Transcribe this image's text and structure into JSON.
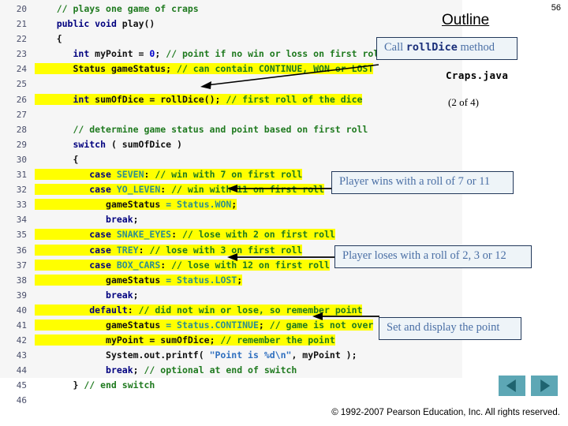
{
  "page": {
    "number": "56",
    "title": "Outline",
    "file_label": "Craps.java",
    "progress": "(2 of 4)"
  },
  "code": {
    "first_line_number": 20,
    "lines": [
      {
        "n": "20",
        "hl": false,
        "segs": [
          {
            "t": "    ",
            "c": "pl"
          },
          {
            "t": "// plays one game of craps",
            "c": "cm"
          }
        ]
      },
      {
        "n": "21",
        "hl": false,
        "segs": [
          {
            "t": "    ",
            "c": "pl"
          },
          {
            "t": "public void ",
            "c": "kw"
          },
          {
            "t": "play()",
            "c": "pl"
          }
        ]
      },
      {
        "n": "22",
        "hl": false,
        "segs": [
          {
            "t": "    {",
            "c": "pl"
          }
        ]
      },
      {
        "n": "23",
        "hl": false,
        "segs": [
          {
            "t": "       ",
            "c": "pl"
          },
          {
            "t": "int ",
            "c": "kw"
          },
          {
            "t": "myPoint = ",
            "c": "pl"
          },
          {
            "t": "0",
            "c": "num"
          },
          {
            "t": "; ",
            "c": "pl"
          },
          {
            "t": "// point if no win or loss on first roll",
            "c": "cm"
          }
        ]
      },
      {
        "n": "24",
        "hl": true,
        "segs": [
          {
            "t": "       ",
            "c": "pl"
          },
          {
            "t": "Status ",
            "c": "pl"
          },
          {
            "t": "gameStatus; ",
            "c": "pl"
          },
          {
            "t": "// can contain CONTINUE, WON or LOST",
            "c": "cm"
          }
        ]
      },
      {
        "n": "25",
        "hl": false,
        "segs": [
          {
            "t": "",
            "c": "pl"
          }
        ]
      },
      {
        "n": "26",
        "hl": true,
        "segs": [
          {
            "t": "       ",
            "c": "pl"
          },
          {
            "t": "int ",
            "c": "kw"
          },
          {
            "t": "sumOfDice = rollDice(); ",
            "c": "pl"
          },
          {
            "t": "// first roll of the dice",
            "c": "cm"
          }
        ]
      },
      {
        "n": "27",
        "hl": false,
        "segs": [
          {
            "t": "",
            "c": "pl"
          }
        ]
      },
      {
        "n": "28",
        "hl": false,
        "segs": [
          {
            "t": "       ",
            "c": "pl"
          },
          {
            "t": "// determine game status and point based on first roll",
            "c": "cm"
          }
        ]
      },
      {
        "n": "29",
        "hl": false,
        "segs": [
          {
            "t": "       ",
            "c": "pl"
          },
          {
            "t": "switch ",
            "c": "kw"
          },
          {
            "t": "( sumOfDice )",
            "c": "pl"
          }
        ]
      },
      {
        "n": "30",
        "hl": false,
        "segs": [
          {
            "t": "       {",
            "c": "pl"
          }
        ]
      },
      {
        "n": "31",
        "hl": true,
        "segs": [
          {
            "t": "          ",
            "c": "pl"
          },
          {
            "t": "case ",
            "c": "kw"
          },
          {
            "t": "SEVEN",
            "c": "ty"
          },
          {
            "t": ": ",
            "c": "pl"
          },
          {
            "t": "// win with 7 on first roll",
            "c": "cm"
          }
        ]
      },
      {
        "n": "32",
        "hl": true,
        "segs": [
          {
            "t": "          ",
            "c": "pl"
          },
          {
            "t": "case ",
            "c": "kw"
          },
          {
            "t": "YO_LEVEN",
            "c": "ty"
          },
          {
            "t": ": ",
            "c": "pl"
          },
          {
            "t": "// win with 11 on first roll",
            "c": "cm"
          }
        ]
      },
      {
        "n": "33",
        "hl": true,
        "segs": [
          {
            "t": "             ",
            "c": "pl"
          },
          {
            "t": "gameStatus ",
            "c": "pl"
          },
          {
            "t": "= ",
            "c": "ty"
          },
          {
            "t": "Status.",
            "c": "ty"
          },
          {
            "t": "WON",
            "c": "ty"
          },
          {
            "t": ";",
            "c": "pl"
          }
        ]
      },
      {
        "n": "34",
        "hl": false,
        "segs": [
          {
            "t": "             ",
            "c": "pl"
          },
          {
            "t": "break",
            "c": "kw"
          },
          {
            "t": ";",
            "c": "pl"
          }
        ]
      },
      {
        "n": "35",
        "hl": true,
        "segs": [
          {
            "t": "          ",
            "c": "pl"
          },
          {
            "t": "case ",
            "c": "kw"
          },
          {
            "t": "SNAKE_EYES",
            "c": "ty"
          },
          {
            "t": ": ",
            "c": "pl"
          },
          {
            "t": "// lose with 2 on first roll",
            "c": "cm"
          }
        ]
      },
      {
        "n": "36",
        "hl": true,
        "segs": [
          {
            "t": "          ",
            "c": "pl"
          },
          {
            "t": "case ",
            "c": "kw"
          },
          {
            "t": "TREY",
            "c": "ty"
          },
          {
            "t": ": ",
            "c": "pl"
          },
          {
            "t": "// lose with 3 on first roll",
            "c": "cm"
          }
        ]
      },
      {
        "n": "37",
        "hl": true,
        "segs": [
          {
            "t": "          ",
            "c": "pl"
          },
          {
            "t": "case ",
            "c": "kw"
          },
          {
            "t": "BOX_CARS",
            "c": "ty"
          },
          {
            "t": ": ",
            "c": "pl"
          },
          {
            "t": "// lose with 12 on first roll",
            "c": "cm"
          }
        ]
      },
      {
        "n": "38",
        "hl": true,
        "segs": [
          {
            "t": "             ",
            "c": "pl"
          },
          {
            "t": "gameStatus ",
            "c": "pl"
          },
          {
            "t": "= ",
            "c": "ty"
          },
          {
            "t": "Status.",
            "c": "ty"
          },
          {
            "t": "LOST",
            "c": "ty"
          },
          {
            "t": ";",
            "c": "pl"
          }
        ]
      },
      {
        "n": "39",
        "hl": false,
        "segs": [
          {
            "t": "             ",
            "c": "pl"
          },
          {
            "t": "break",
            "c": "kw"
          },
          {
            "t": ";",
            "c": "pl"
          }
        ]
      },
      {
        "n": "40",
        "hl": true,
        "segs": [
          {
            "t": "          ",
            "c": "pl"
          },
          {
            "t": "default",
            "c": "kw"
          },
          {
            "t": ": ",
            "c": "pl"
          },
          {
            "t": "// did not win or lose, so remember point",
            "c": "cm"
          }
        ]
      },
      {
        "n": "41",
        "hl": true,
        "segs": [
          {
            "t": "             ",
            "c": "pl"
          },
          {
            "t": "gameStatus ",
            "c": "pl"
          },
          {
            "t": "= ",
            "c": "ty"
          },
          {
            "t": "Status.CONTINUE",
            "c": "ty"
          },
          {
            "t": "; ",
            "c": "pl"
          },
          {
            "t": "// game is not over",
            "c": "cm"
          }
        ]
      },
      {
        "n": "42",
        "hl": true,
        "segs": [
          {
            "t": "             ",
            "c": "pl"
          },
          {
            "t": "myPoint = sumOfDice; ",
            "c": "pl"
          },
          {
            "t": "// remember the point",
            "c": "cm"
          }
        ]
      },
      {
        "n": "43",
        "hl": false,
        "segs": [
          {
            "t": "             ",
            "c": "pl"
          },
          {
            "t": "System.out.printf( ",
            "c": "pl"
          },
          {
            "t": "\"Point is %d\\n\"",
            "c": "str"
          },
          {
            "t": ", myPoint );",
            "c": "pl"
          }
        ]
      },
      {
        "n": "44",
        "hl": false,
        "segs": [
          {
            "t": "             ",
            "c": "pl"
          },
          {
            "t": "break",
            "c": "kw"
          },
          {
            "t": "; ",
            "c": "pl"
          },
          {
            "t": "// optional at end of switch",
            "c": "cm"
          }
        ]
      },
      {
        "n": "45",
        "hl": false,
        "segs": [
          {
            "t": "       } ",
            "c": "pl"
          },
          {
            "t": "// end switch",
            "c": "cm"
          }
        ]
      },
      {
        "n": "46",
        "hl": false,
        "segs": [
          {
            "t": "",
            "c": "pl"
          }
        ]
      }
    ]
  },
  "callouts": {
    "rolldice": {
      "prefix": "Call ",
      "code": "rollDice",
      "suffix": " method"
    },
    "win": "Player wins with a roll of 7 or 11",
    "lose": "Player loses with a roll of 2, 3 or 12",
    "point": "Set and display the point"
  },
  "nav": {
    "prev_label": "previous-slide",
    "next_label": "next-slide"
  },
  "footer": {
    "copyright": "© 1992-2007 Pearson Education, Inc.  All rights reserved."
  },
  "colors": {
    "highlight": "#ffff00",
    "callout_border": "#23395b",
    "callout_bg": "#eef4f8",
    "callout_text": "#4a6fa5",
    "nav_button": "#5da7b5",
    "nav_arrow": "#1f6470",
    "code_panel_bg": "#f6f6f6"
  }
}
